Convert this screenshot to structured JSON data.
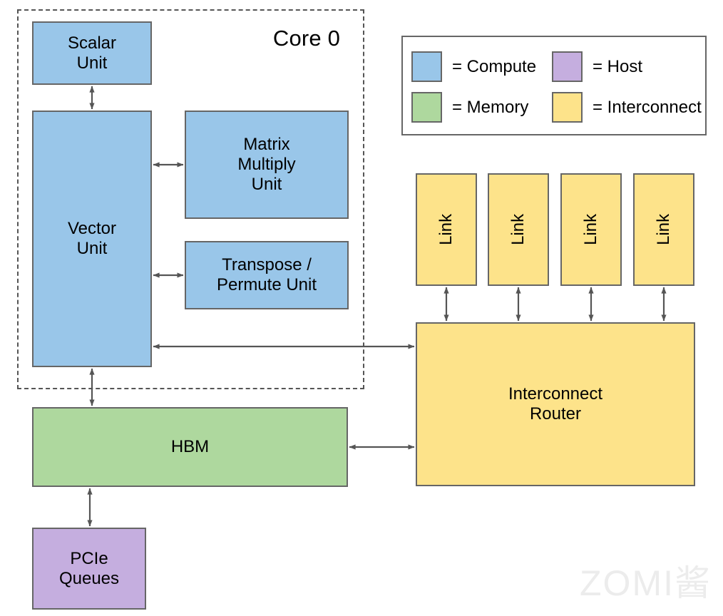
{
  "diagram": {
    "title": "Core 0",
    "watermark": "ZOMI酱"
  },
  "core": {
    "label": "Core 0",
    "units": [
      {
        "id": "scalar-unit",
        "label": "Scalar\nUnit",
        "category": "Compute"
      },
      {
        "id": "vector-unit",
        "label": "Vector\nUnit",
        "category": "Compute"
      },
      {
        "id": "matrix-unit",
        "label": "Matrix\nMultiply\nUnit",
        "category": "Compute"
      },
      {
        "id": "transpose-unit",
        "label": "Transpose /\nPermute Unit",
        "category": "Compute"
      }
    ]
  },
  "memory": {
    "hbm_label": "HBM"
  },
  "host": {
    "pcie_label": "PCIe\nQueues"
  },
  "interconnect": {
    "router_label": "Interconnect\nRouter",
    "links": [
      {
        "label": "Link"
      },
      {
        "label": "Link"
      },
      {
        "label": "Link"
      },
      {
        "label": "Link"
      }
    ]
  },
  "legend": {
    "items": [
      {
        "label": "= Compute",
        "color": "#99c6e9"
      },
      {
        "label": "= Host",
        "color": "#c5aedf"
      },
      {
        "label": "= Memory",
        "color": "#aed89e"
      },
      {
        "label": "= Interconnect",
        "color": "#fde38a"
      }
    ]
  },
  "colors": {
    "compute": "#99c6e9",
    "memory": "#aed89e",
    "host": "#c5aedf",
    "interconnect": "#fde38a",
    "stroke": "#666666",
    "arrow": "#555555",
    "background": "#ffffff"
  },
  "connections": [
    {
      "from": "scalar-unit",
      "to": "vector-unit",
      "direction": "bidirectional"
    },
    {
      "from": "vector-unit",
      "to": "matrix-unit",
      "direction": "bidirectional"
    },
    {
      "from": "vector-unit",
      "to": "transpose-unit",
      "direction": "bidirectional"
    },
    {
      "from": "vector-unit",
      "to": "router",
      "direction": "bidirectional"
    },
    {
      "from": "vector-unit",
      "to": "hbm",
      "direction": "bidirectional"
    },
    {
      "from": "hbm",
      "to": "pcie-queues",
      "direction": "bidirectional"
    },
    {
      "from": "hbm",
      "to": "router",
      "direction": "bidirectional"
    },
    {
      "from": "link-0",
      "to": "router",
      "direction": "bidirectional"
    },
    {
      "from": "link-1",
      "to": "router",
      "direction": "bidirectional"
    },
    {
      "from": "link-2",
      "to": "router",
      "direction": "bidirectional"
    },
    {
      "from": "link-3",
      "to": "router",
      "direction": "bidirectional"
    }
  ]
}
